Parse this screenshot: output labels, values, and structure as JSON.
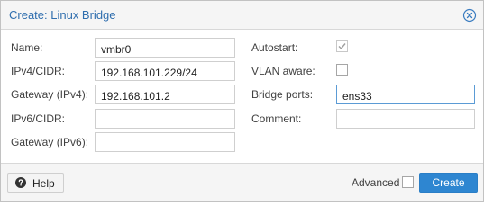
{
  "window": {
    "title": "Create: Linux Bridge",
    "close_icon": "close-circle-icon"
  },
  "form": {
    "left": [
      {
        "key": "name",
        "label": "Name:",
        "value": "vmbr0"
      },
      {
        "key": "ipv4",
        "label": "IPv4/CIDR:",
        "value": "192.168.101.229/24"
      },
      {
        "key": "gw4",
        "label": "Gateway (IPv4):",
        "value": "192.168.101.2"
      },
      {
        "key": "ipv6",
        "label": "IPv6/CIDR:",
        "value": ""
      },
      {
        "key": "gw6",
        "label": "Gateway (IPv6):",
        "value": ""
      }
    ],
    "autostart": {
      "label": "Autostart:",
      "checked": true
    },
    "vlan_aware": {
      "label": "VLAN aware:",
      "checked": false
    },
    "bridge_ports": {
      "label": "Bridge ports:",
      "value": "ens33"
    },
    "comment": {
      "label": "Comment:",
      "value": ""
    }
  },
  "footer": {
    "help_label": "Help",
    "help_icon": "question-circle-icon",
    "advanced_label": "Advanced",
    "advanced_checked": false,
    "create_label": "Create"
  },
  "colors": {
    "accent": "#2e86d1",
    "title": "#2f6eae",
    "focus_border": "#5b9bd5"
  }
}
